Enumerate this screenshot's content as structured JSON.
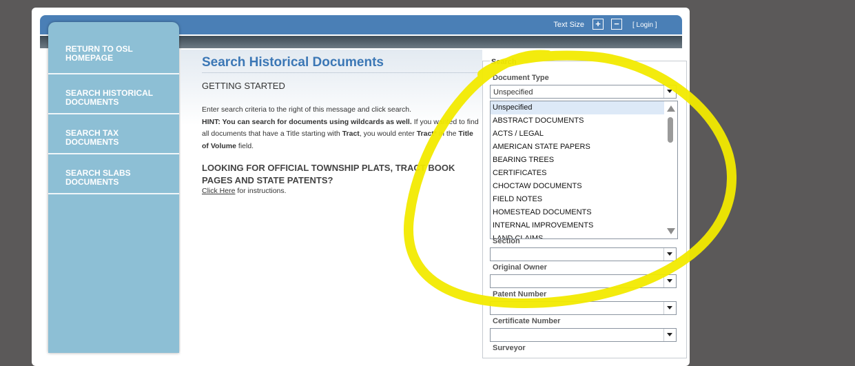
{
  "topbar": {
    "text_size_label": "Text Size",
    "plus_label": "+",
    "minus_label": "−",
    "login_label": "[ Login ]"
  },
  "sidebar": {
    "items": [
      {
        "label": "RETURN TO OSL HOMEPAGE"
      },
      {
        "label": "SEARCH HISTORICAL DOCUMENTS"
      },
      {
        "label": "SEARCH TAX DOCUMENTS"
      },
      {
        "label": "SEARCH SLABS DOCUMENTS"
      }
    ]
  },
  "main": {
    "title": "Search Historical Documents",
    "getting_started": "GETTING STARTED",
    "line1": "Enter search criteria to the right of this message and click search.",
    "hint_bold": "HINT: You can search for documents using wildcards as well.",
    "hint_rest": " If you wanted to find all documents that have a Title starting with ",
    "hint_tract": "Tract",
    "hint_mid": ", you would enter ",
    "hint_tract_star": "Tract*",
    "hint_in": " in the ",
    "hint_field": "Title of Volume",
    "hint_end": " field.",
    "plats_heading": "LOOKING FOR OFFICIAL TOWNSHIP PLATS, TRACT BOOK PAGES AND STATE PATENTS?",
    "click_here": "Click Here",
    "instructions": " for instructions."
  },
  "search": {
    "legend": "Search",
    "document_type_label": "Document Type",
    "document_type_value": "Unspecified",
    "document_type_options": [
      "Unspecified",
      "ABSTRACT DOCUMENTS",
      "ACTS / LEGAL",
      "AMERICAN STATE PAPERS",
      "BEARING TREES",
      "CERTIFICATES",
      "CHOCTAW DOCUMENTS",
      "FIELD NOTES",
      "HOMESTEAD DOCUMENTS",
      "INTERNAL IMPROVEMENTS",
      "LAND CLAIMS"
    ],
    "section_label": "Section",
    "original_owner_label": "Original Owner",
    "patent_number_label": "Patent Number",
    "certificate_number_label": "Certificate Number",
    "surveyor_label": "Surveyor"
  },
  "colors": {
    "topbar": "#4a7fb6",
    "sidebar": "#8dbfd5",
    "title": "#3b77b5",
    "annotation": "#f2ea00"
  }
}
